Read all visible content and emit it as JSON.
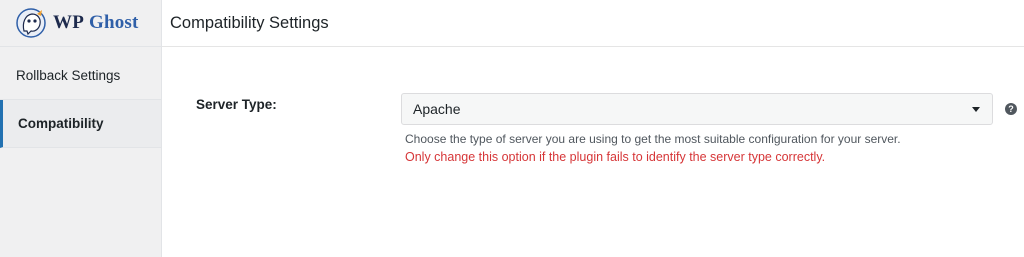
{
  "sidebar": {
    "logo": {
      "text_wp": "WP",
      "text_ghost": "Ghost"
    },
    "items": [
      {
        "label": "Rollback Settings"
      },
      {
        "label": "Compatibility"
      }
    ]
  },
  "header": {
    "title": "Compatibility Settings"
  },
  "form": {
    "server_type": {
      "label": "Server Type:",
      "value": "Apache",
      "help_icon": "question-circle-icon",
      "help_glyph": "?",
      "description": "Choose the type of server you are using to get the most suitable configuration for your server.",
      "warning": "Only change this option if the plugin fails to identify the server type correctly."
    }
  },
  "colors": {
    "accent": "#2271b1",
    "warning": "#d63638"
  }
}
